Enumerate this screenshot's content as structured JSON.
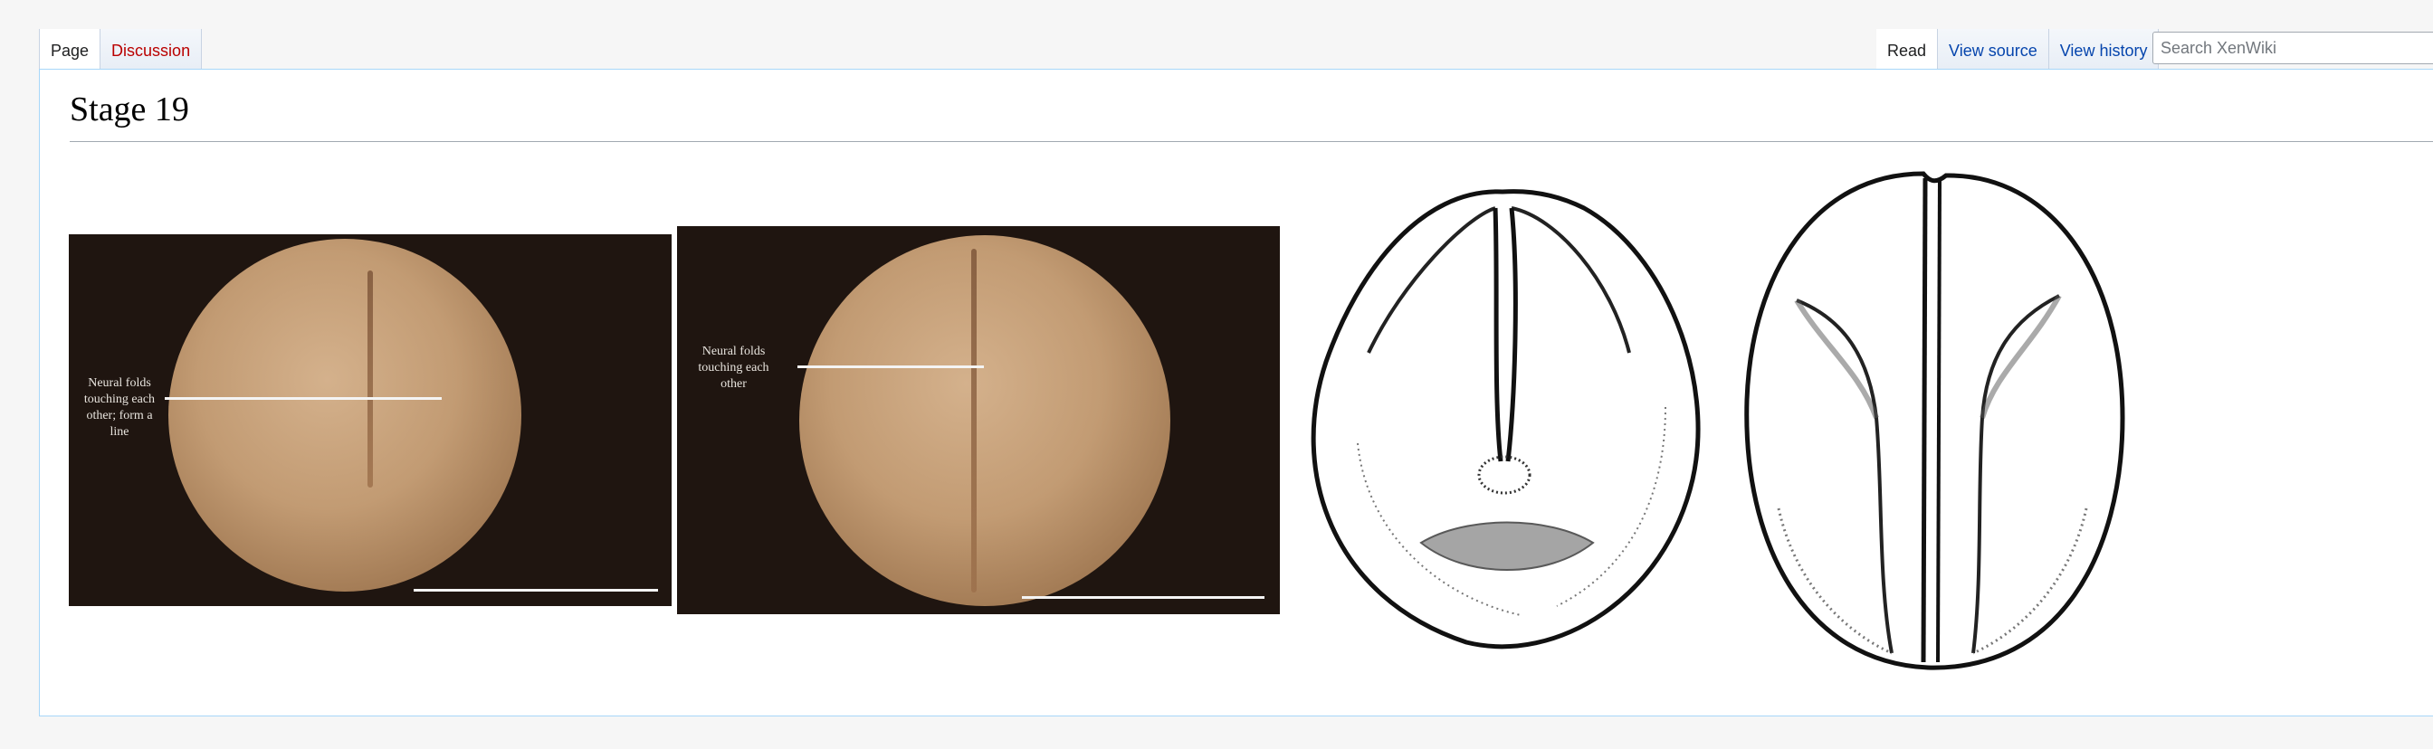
{
  "tabs_left": [
    {
      "label": "Page",
      "selected": true
    },
    {
      "label": "Discussion",
      "selected": false
    }
  ],
  "tabs_right": [
    {
      "label": "Read",
      "selected": true
    },
    {
      "label": "View source",
      "selected": false
    },
    {
      "label": "View history",
      "selected": false
    }
  ],
  "search": {
    "placeholder": "Search XenWiki"
  },
  "page": {
    "title": "Stage 19"
  },
  "figures": [
    {
      "kind": "photo",
      "annotation": "Neural folds\ntouching each\nother; form a\nline"
    },
    {
      "kind": "photo",
      "annotation": "Neural folds\ntouching each\nother"
    },
    {
      "kind": "drawing",
      "view": "dorsal-posterior"
    },
    {
      "kind": "drawing",
      "view": "dorsal"
    }
  ],
  "colors": {
    "link": "#0645ad",
    "new_link": "#ba0000",
    "content_border": "#a7d7f9"
  }
}
